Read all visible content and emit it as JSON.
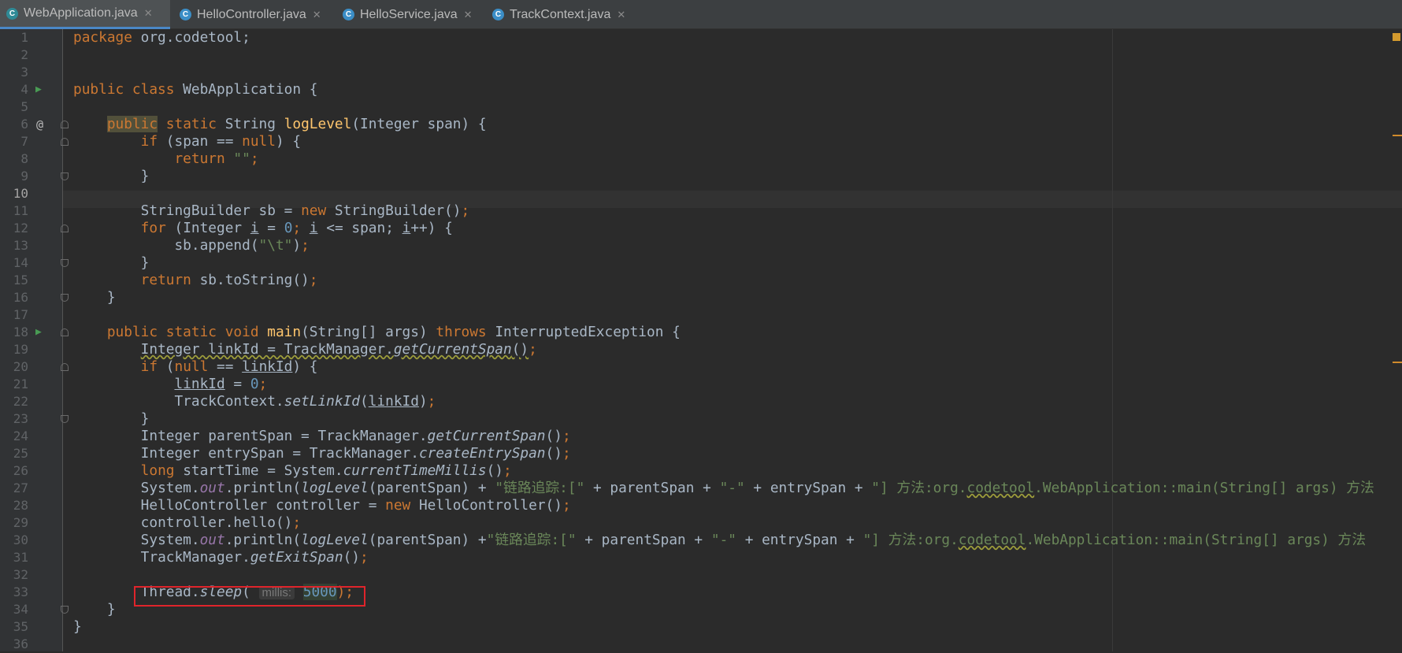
{
  "tabs": [
    {
      "label": "WebApplication.java",
      "active": true,
      "icon": "class-run-icon"
    },
    {
      "label": "HelloController.java",
      "active": false,
      "icon": "class-icon"
    },
    {
      "label": "HelloService.java",
      "active": false,
      "icon": "class-icon"
    },
    {
      "label": "TrackContext.java",
      "active": false,
      "icon": "class-icon"
    }
  ],
  "gutter": {
    "line_numbers": [
      "1",
      "2",
      "3",
      "4",
      "5",
      "6",
      "7",
      "8",
      "9",
      "10",
      "11",
      "12",
      "13",
      "14",
      "15",
      "16",
      "17",
      "18",
      "19",
      "20",
      "21",
      "22",
      "23",
      "24",
      "25",
      "26",
      "27",
      "28",
      "29",
      "30",
      "31",
      "32",
      "33",
      "34",
      "35",
      "36"
    ],
    "current_line": "10",
    "run_icon_lines": [
      "4",
      "18"
    ],
    "override_icon_line": "6",
    "override_icon_text": "@"
  },
  "code": {
    "package_kw": "package",
    "package_name": " org.codetool;",
    "class_decl_kw": "public class",
    "class_name": " WebApplication {",
    "loglevel_public": "public",
    "loglevel_static": "static",
    "loglevel_type": " String ",
    "loglevel_name": "logLevel",
    "loglevel_params": "(Integer span) {",
    "if1_kw": "if",
    "if1_cond_a": " (span == ",
    "null_kw": "null",
    "if1_cond_b": ") {",
    "return_kw": "return",
    "empty_str": "\"\"",
    "semicolon": ";",
    "close_brace": "}",
    "sb_decl_a": "StringBuilder sb = ",
    "new_kw": "new",
    "sb_decl_b": " StringBuilder()",
    "for_kw": "for",
    "for_a": " (Integer ",
    "var_i": "i",
    "for_b": " = ",
    "zero": "0",
    "for_c": "; ",
    "for_d": " <= span; ",
    "for_e": "++) {",
    "append_a": "sb.append(",
    "tab_str": "\"\\t\"",
    "append_b": ")",
    "return2_b": " sb.toString()",
    "main_mods": "public static void",
    "main_name": "main",
    "main_params": "(String[] args) ",
    "throws_kw": "throws",
    "main_exc": " InterruptedException {",
    "l19_a": "Integer linkId = TrackManager.",
    "get_current_span": "getCurrentSpan",
    "parens": "()",
    "l20_a": " (",
    "l20_b": " == ",
    "link_id": "linkId",
    "l20_c": ") {",
    "l21_b": " = ",
    "l22_a": "TrackContext.",
    "set_link_id": "setLinkId",
    "open_paren": "(",
    "close_paren": ")",
    "l24_a": "Integer parentSpan = TrackManager.",
    "l25_a": "Integer entrySpan = TrackManager.",
    "create_entry_span": "createEntrySpan",
    "long_kw": "long",
    "l26_a": " startTime = System.",
    "current_time_millis": "currentTimeMillis",
    "system_dot": "System.",
    "out": "out",
    "println_a": ".println(",
    "log_level_call": "logLevel",
    "println_b": "(parentSpan) + ",
    "println_b2": "(parentSpan) +",
    "str_trace": "\"链路追踪:[\"",
    "plus_parent": " + parentSpan + ",
    "dash_str": "\"-\"",
    "plus_entry": " + entrySpan + ",
    "str_method_a": "\"] 方法:org.",
    "codetool_word": "codetool",
    "str_method_b": ".WebApplication::main(String[] args) 方法",
    "l28_a": "HelloController controller = ",
    "l28_b": " HelloController()",
    "l29": "controller.hello()",
    "l31_a": "TrackManager.",
    "get_exit_span": "getExitSpan",
    "l33_a": "Thread.",
    "sleep": "sleep",
    "l33_b": "( ",
    "param_hint": "millis:",
    "sleep_value": "5000",
    "l33_c": ");"
  },
  "colors": {
    "background": "#2b2b2b",
    "keyword": "#cc7832",
    "string": "#6a8759",
    "number": "#6897bb",
    "method_decl": "#ffc66d",
    "static_field": "#9876aa",
    "highlight_box": "#e0242b"
  }
}
